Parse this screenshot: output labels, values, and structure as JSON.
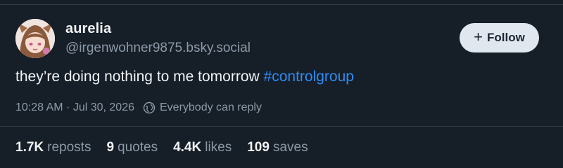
{
  "author": {
    "display_name": "aurelia",
    "handle": "@irgenwohner9875.bsky.social",
    "avatar": "anime-avatar"
  },
  "follow_button": {
    "icon": "plus-icon",
    "icon_glyph": "+",
    "label": "Follow"
  },
  "post": {
    "text": "they’re doing nothing to me tomorrow ",
    "hashtag": "#controlgroup"
  },
  "meta": {
    "timestamp": "10:28 AM · Jul 30, 2026",
    "reply_icon": "globe-icon",
    "reply_setting": "Everybody can reply"
  },
  "stats": {
    "reposts": {
      "count": "1.7K",
      "label": "reposts"
    },
    "quotes": {
      "count": "9",
      "label": "quotes"
    },
    "likes": {
      "count": "4.4K",
      "label": "likes"
    },
    "saves": {
      "count": "109",
      "label": "saves"
    }
  },
  "colors": {
    "background": "#161e27",
    "text": "#f1f3f5",
    "muted": "#8c9aa8",
    "link": "#2f8cf5",
    "follow_bg": "#e0e7ee"
  }
}
